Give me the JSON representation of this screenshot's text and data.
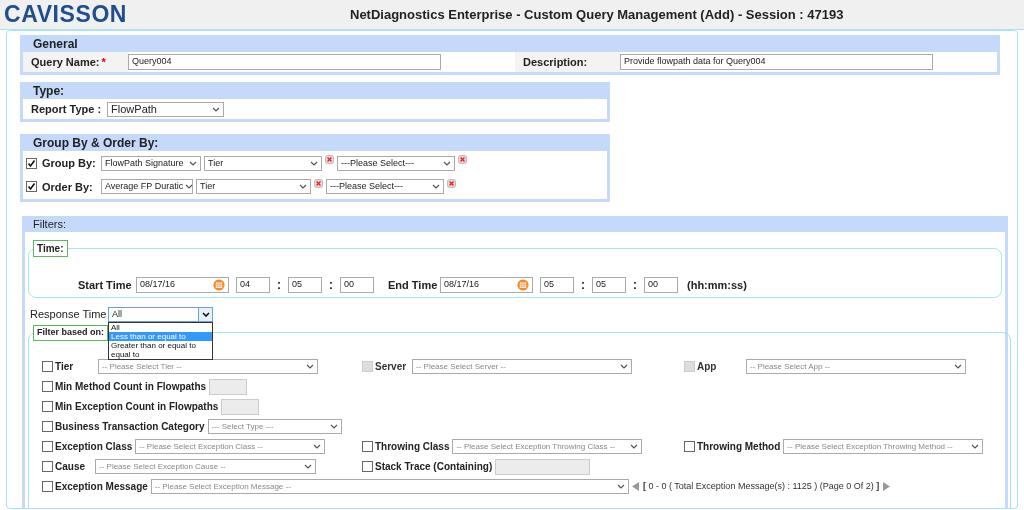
{
  "header": {
    "logo": "CAVISSON",
    "title": "NetDiagnostics Enterprise - Custom Query Management (Add) - Session : 47193"
  },
  "general": {
    "title": "General",
    "fields": [
      {
        "label": "Query Name:",
        "required_mark": "*",
        "value": "Query004"
      },
      {
        "label": "Description:",
        "value": "Provide flowpath data for Query004"
      }
    ]
  },
  "type": {
    "title": "Type:",
    "report_type": {
      "label": "Report Type :",
      "value": "FlowPath"
    }
  },
  "group_order": {
    "title": "Group By & Order By:",
    "rows": [
      {
        "label": "Group By:",
        "checked": true,
        "selects": [
          "FlowPath Signature",
          "Tier",
          "---Please Select---"
        ]
      },
      {
        "label": "Order By:",
        "checked": true,
        "selects": [
          "Average FP Duratic",
          "Tier",
          "---Please Select---"
        ]
      }
    ]
  },
  "filters": {
    "title": "Filters:",
    "time": {
      "legend": "Time:",
      "ranges": [
        {
          "label": "Start Time",
          "date": "08/17/16",
          "parts": [
            {
              "kind": "field",
              "value": "04"
            },
            {
              "kind": "separator",
              "value": ":"
            },
            {
              "kind": "field",
              "value": "05"
            },
            {
              "kind": "separator",
              "value": ":"
            },
            {
              "kind": "field",
              "value": "00"
            }
          ]
        },
        {
          "label": "End Time",
          "date": "08/17/16",
          "parts": [
            {
              "kind": "field",
              "value": "05"
            },
            {
              "kind": "separator",
              "value": ":"
            },
            {
              "kind": "field",
              "value": "05"
            },
            {
              "kind": "separator",
              "value": ":"
            },
            {
              "kind": "field",
              "value": "00"
            }
          ]
        }
      ],
      "format": "(hh:mm:ss)"
    },
    "response_time": {
      "label": "Response Time",
      "value": "All",
      "expanded": true,
      "options": [
        {
          "label": "All",
          "highlighted": false
        },
        {
          "label": "Less than or equal to",
          "highlighted": true
        },
        {
          "label": "Greater than or equal to",
          "highlighted": false
        },
        {
          "label": "equal to",
          "highlighted": false
        }
      ]
    },
    "filter_based_on": {
      "legend": "Filter based on:",
      "rows": [
        {
          "cells": [
            {
              "kind": "select",
              "label": "Tier",
              "checked": false,
              "disabled": false,
              "placeholder": "-- Please Select Tier --"
            },
            {
              "kind": "select",
              "label": "Server",
              "checked": false,
              "disabled": true,
              "placeholder": "-- Please Select Server --"
            },
            {
              "kind": "select",
              "label": "App",
              "checked": false,
              "disabled": true,
              "placeholder": "-- Please Select App --"
            }
          ]
        },
        {
          "cells": [
            {
              "kind": "input",
              "label": "Min Method Count in Flowpaths",
              "checked": false,
              "disabled": false
            }
          ]
        },
        {
          "cells": [
            {
              "kind": "input",
              "label": "Min Exception Count in Flowpaths",
              "checked": false,
              "disabled": false
            }
          ]
        },
        {
          "cells": [
            {
              "kind": "select",
              "label": "Business Transaction Category",
              "checked": false,
              "disabled": false,
              "placeholder": "--- Select Type ---"
            }
          ]
        },
        {
          "cells": [
            {
              "kind": "select",
              "label": "Exception Class",
              "checked": false,
              "disabled": false,
              "placeholder": "-- Please Select Exception Class --"
            },
            {
              "kind": "select",
              "label": "Throwing Class",
              "checked": false,
              "disabled": false,
              "placeholder": "-- Please Select Exception Throwing Class --"
            },
            {
              "kind": "select",
              "label": "Throwing Method",
              "checked": false,
              "disabled": false,
              "placeholder": "-- Please Select Exception Throwing Method --"
            }
          ]
        },
        {
          "cells": [
            {
              "kind": "select",
              "label": "Cause",
              "checked": false,
              "disabled": false,
              "placeholder": "-- Please Select Exception Cause --"
            },
            {
              "kind": "input",
              "label": "Stack Trace (Containing)",
              "checked": false,
              "disabled": false
            }
          ]
        },
        {
          "cells": [
            {
              "kind": "select",
              "label": "Exception Message",
              "checked": false,
              "disabled": false,
              "placeholder": "-- Please Select Exception Message --"
            },
            "",
            {
              "kind": "pager",
              "text": "**[** 0 - 0 ( Total Exception Message(s) : 1125 ) (Page 0 Of 2) **]**"
            }
          ]
        }
      ]
    }
  }
}
